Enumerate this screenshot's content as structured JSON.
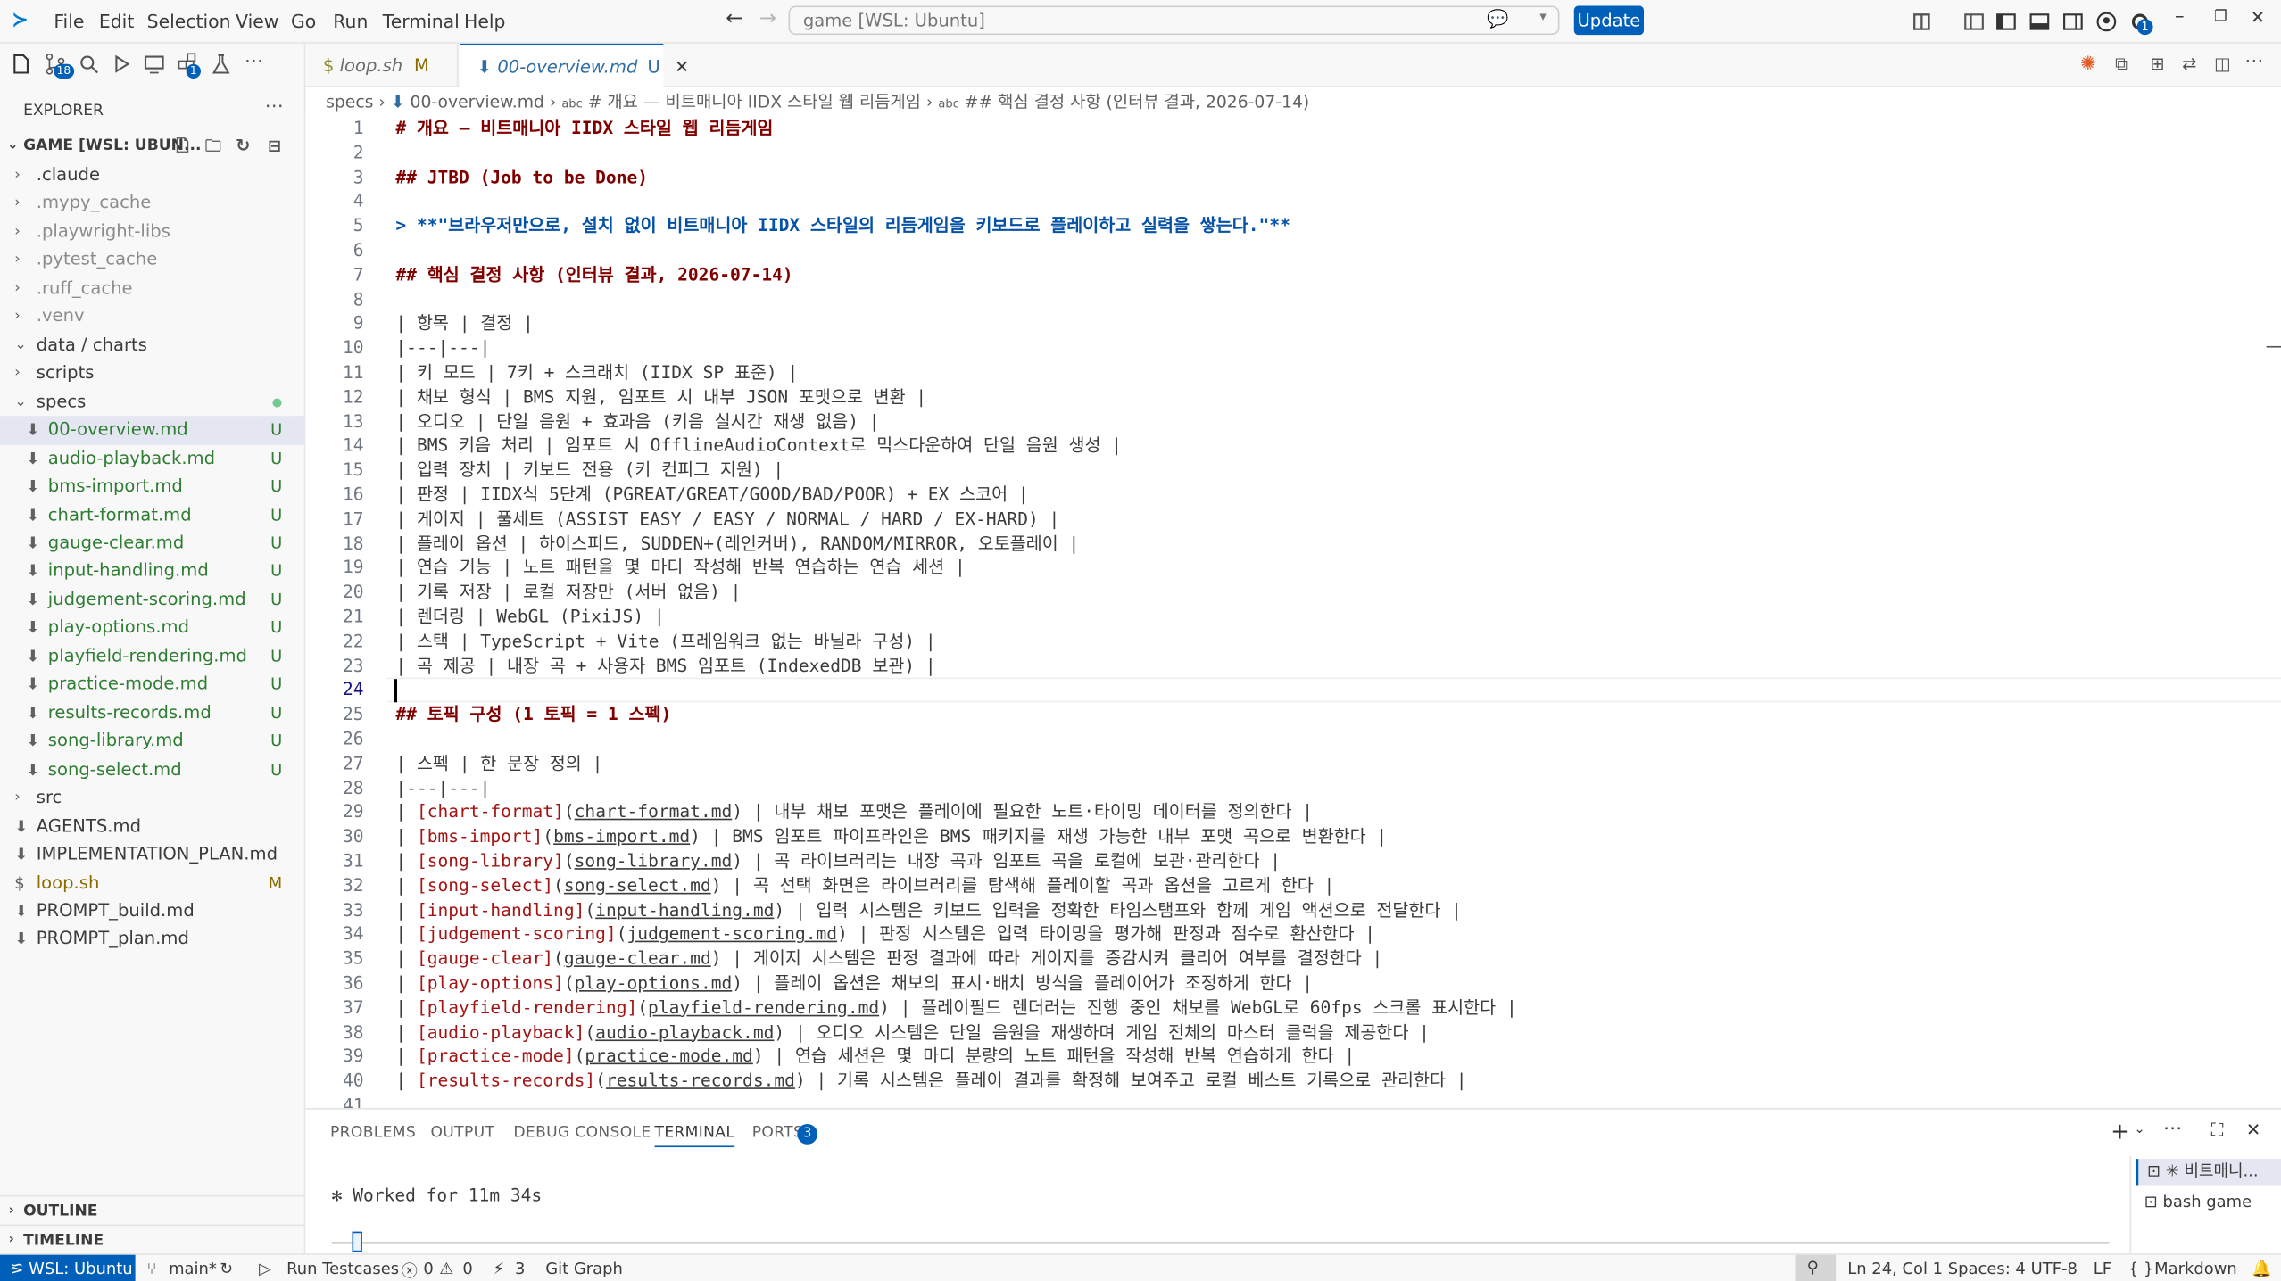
{
  "menubar": {
    "file": "File",
    "edit": "Edit",
    "selection": "Selection",
    "view": "View",
    "go": "Go",
    "run": "Run",
    "terminal": "Terminal",
    "help": "Help"
  },
  "command_center": "game [WSL: Ubuntu]",
  "update_button": "Update",
  "explorer": {
    "title": "EXPLORER",
    "workspace": "GAME [WSL: UBUN...",
    "items": [
      {
        "label": ".claude",
        "type": "folder",
        "open": false,
        "depth": 1,
        "dim": false,
        "badge": ""
      },
      {
        "label": ".mypy_cache",
        "type": "folder",
        "open": false,
        "depth": 1,
        "dim": true,
        "badge": ""
      },
      {
        "label": ".playwright-libs",
        "type": "folder",
        "open": false,
        "depth": 1,
        "dim": true,
        "badge": ""
      },
      {
        "label": ".pytest_cache",
        "type": "folder",
        "open": false,
        "depth": 1,
        "dim": true,
        "badge": ""
      },
      {
        "label": ".ruff_cache",
        "type": "folder",
        "open": false,
        "depth": 1,
        "dim": true,
        "badge": ""
      },
      {
        "label": ".venv",
        "type": "folder",
        "open": false,
        "depth": 1,
        "dim": true,
        "badge": ""
      },
      {
        "label": "data / charts",
        "type": "folder",
        "open": true,
        "depth": 1,
        "dim": false,
        "badge": ""
      },
      {
        "label": "scripts",
        "type": "folder",
        "open": false,
        "depth": 1,
        "dim": false,
        "badge": ""
      },
      {
        "label": "specs",
        "type": "folder",
        "open": true,
        "depth": 1,
        "dim": false,
        "badge": "dot",
        "color": "green"
      },
      {
        "label": "00-overview.md",
        "type": "md",
        "depth": 2,
        "badge": "U",
        "color": "green",
        "selected": true
      },
      {
        "label": "audio-playback.md",
        "type": "md",
        "depth": 2,
        "badge": "U",
        "color": "green"
      },
      {
        "label": "bms-import.md",
        "type": "md",
        "depth": 2,
        "badge": "U",
        "color": "green"
      },
      {
        "label": "chart-format.md",
        "type": "md",
        "depth": 2,
        "badge": "U",
        "color": "green"
      },
      {
        "label": "gauge-clear.md",
        "type": "md",
        "depth": 2,
        "badge": "U",
        "color": "green"
      },
      {
        "label": "input-handling.md",
        "type": "md",
        "depth": 2,
        "badge": "U",
        "color": "green"
      },
      {
        "label": "judgement-scoring.md",
        "type": "md",
        "depth": 2,
        "badge": "U",
        "color": "green"
      },
      {
        "label": "play-options.md",
        "type": "md",
        "depth": 2,
        "badge": "U",
        "color": "green"
      },
      {
        "label": "playfield-rendering.md",
        "type": "md",
        "depth": 2,
        "badge": "U",
        "color": "green"
      },
      {
        "label": "practice-mode.md",
        "type": "md",
        "depth": 2,
        "badge": "U",
        "color": "green"
      },
      {
        "label": "results-records.md",
        "type": "md",
        "depth": 2,
        "badge": "U",
        "color": "green"
      },
      {
        "label": "song-library.md",
        "type": "md",
        "depth": 2,
        "badge": "U",
        "color": "green"
      },
      {
        "label": "song-select.md",
        "type": "md",
        "depth": 2,
        "badge": "U",
        "color": "green"
      },
      {
        "label": "src",
        "type": "folder",
        "open": false,
        "depth": 1,
        "badge": ""
      },
      {
        "label": "AGENTS.md",
        "type": "md",
        "depth": 1,
        "badge": ""
      },
      {
        "label": "IMPLEMENTATION_PLAN.md",
        "type": "md",
        "depth": 1,
        "badge": ""
      },
      {
        "label": "loop.sh",
        "type": "sh",
        "depth": 1,
        "badge": "M",
        "color": "amber"
      },
      {
        "label": "PROMPT_build.md",
        "type": "md",
        "depth": 1,
        "badge": ""
      },
      {
        "label": "PROMPT_plan.md",
        "type": "md",
        "depth": 1,
        "badge": ""
      }
    ],
    "outline": "OUTLINE",
    "timeline": "TIMELINE"
  },
  "tabs": [
    {
      "label": "loop.sh",
      "badge": "M"
    },
    {
      "label": "00-overview.md",
      "badge": "U"
    }
  ],
  "breadcrumb": [
    "specs",
    "00-overview.md",
    "# 개요 — 비트매니아 IIDX 스타일 웹 리듬게임",
    "## 핵심 결정 사항 (인터뷰 결과, 2026-07-14)"
  ],
  "editor": {
    "current_line": 24,
    "lines": [
      "# 개요 — 비트매니아 IIDX 스타일 웹 리듬게임",
      "",
      "## JTBD (Job to be Done)",
      "",
      "> **\"브라우저만으로, 설치 없이 비트매니아 IIDX 스타일의 리듬게임을 키보드로 플레이하고 실력을 쌓는다.\"**",
      "",
      "## 핵심 결정 사항 (인터뷰 결과, 2026-07-14)",
      "",
      "| 항목 | 결정 |",
      "|---|---|",
      "| 키 모드 | 7키 + 스크래치 (IIDX SP 표준) |",
      "| 채보 형식 | BMS 지원, 임포트 시 내부 JSON 포맷으로 변환 |",
      "| 오디오 | 단일 음원 + 효과음 (키음 실시간 재생 없음) |",
      "| BMS 키음 처리 | 임포트 시 OfflineAudioContext로 믹스다운하여 단일 음원 생성 |",
      "| 입력 장치 | 키보드 전용 (키 컨피그 지원) |",
      "| 판정 | IIDX식 5단계 (PGREAT/GREAT/GOOD/BAD/POOR) + EX 스코어 |",
      "| 게이지 | 풀세트 (ASSIST EASY / EASY / NORMAL / HARD / EX-HARD) |",
      "| 플레이 옵션 | 하이스피드, SUDDEN+(레인커버), RANDOM/MIRROR, 오토플레이 |",
      "| 연습 기능 | 노트 패턴을 몇 마디 작성해 반복 연습하는 연습 세션 |",
      "| 기록 저장 | 로컬 저장만 (서버 없음) |",
      "| 렌더링 | WebGL (PixiJS) |",
      "| 스택 | TypeScript + Vite (프레임워크 없는 바닐라 구성) |",
      "| 곡 제공 | 내장 곡 + 사용자 BMS 임포트 (IndexedDB 보관) |",
      "",
      "## 토픽 구성 (1 토픽 = 1 스펙)",
      "",
      "| 스펙 | 한 문장 정의 |",
      "|---|---|",
      "| [chart-format](chart-format.md) | 내부 채보 포맷은 플레이에 필요한 노트·타이밍 데이터를 정의한다 |",
      "| [bms-import](bms-import.md) | BMS 임포트 파이프라인은 BMS 패키지를 재생 가능한 내부 포맷 곡으로 변환한다 |",
      "| [song-library](song-library.md) | 곡 라이브러리는 내장 곡과 임포트 곡을 로컬에 보관·관리한다 |",
      "| [song-select](song-select.md) | 곡 선택 화면은 라이브러리를 탐색해 플레이할 곡과 옵션을 고르게 한다 |",
      "| [input-handling](input-handling.md) | 입력 시스템은 키보드 입력을 정확한 타임스탬프와 함께 게임 액션으로 전달한다 |",
      "| [judgement-scoring](judgement-scoring.md) | 판정 시스템은 입력 타이밍을 평가해 판정과 점수로 환산한다 |",
      "| [gauge-clear](gauge-clear.md) | 게이지 시스템은 판정 결과에 따라 게이지를 증감시켜 클리어 여부를 결정한다 |",
      "| [play-options](play-options.md) | 플레이 옵션은 채보의 표시·배치 방식을 플레이어가 조정하게 한다 |",
      "| [playfield-rendering](playfield-rendering.md) | 플레이필드 렌더러는 진행 중인 채보를 WebGL로 60fps 스크롤 표시한다 |",
      "| [audio-playback](audio-playback.md) | 오디오 시스템은 단일 음원을 재생하며 게임 전체의 마스터 클럭을 제공한다 |",
      "| [practice-mode](practice-mode.md) | 연습 세션은 몇 마디 분량의 노트 패턴을 작성해 반복 연습하게 한다 |",
      "| [results-records](results-records.md) | 기록 시스템은 플레이 결과를 확정해 보여주고 로컬 베스트 기록으로 관리한다 |",
      ""
    ]
  },
  "panel": {
    "tabs": [
      "PROBLEMS",
      "OUTPUT",
      "DEBUG CONSOLE",
      "TERMINAL",
      "PORTS"
    ],
    "ports_count": "3",
    "active": "TERMINAL",
    "terminal_text": "✻ Worked for 11m 34s",
    "terminals": [
      {
        "label": "✳ 비트매니..."
      },
      {
        "label": "bash game"
      }
    ]
  },
  "statusbar": {
    "remote": "WSL: Ubuntu",
    "branch": "main*",
    "run_testcases": "Run Testcases",
    "errors": "0",
    "warnings": "0",
    "ports": "3",
    "git_graph": "Git Graph",
    "position": "Ln 24, Col 1",
    "spaces": "Spaces: 4",
    "encoding": "UTF-8",
    "eol": "LF",
    "language": "Markdown"
  },
  "badges": {
    "source_control": "18",
    "extensions": "1",
    "account": "1"
  },
  "colors": {
    "accent": "#005fb8",
    "untracked": "#2e8b3e",
    "modified": "#8b6b00",
    "heading": "#800000",
    "quote": "#0451a5",
    "link": "#a31515"
  }
}
